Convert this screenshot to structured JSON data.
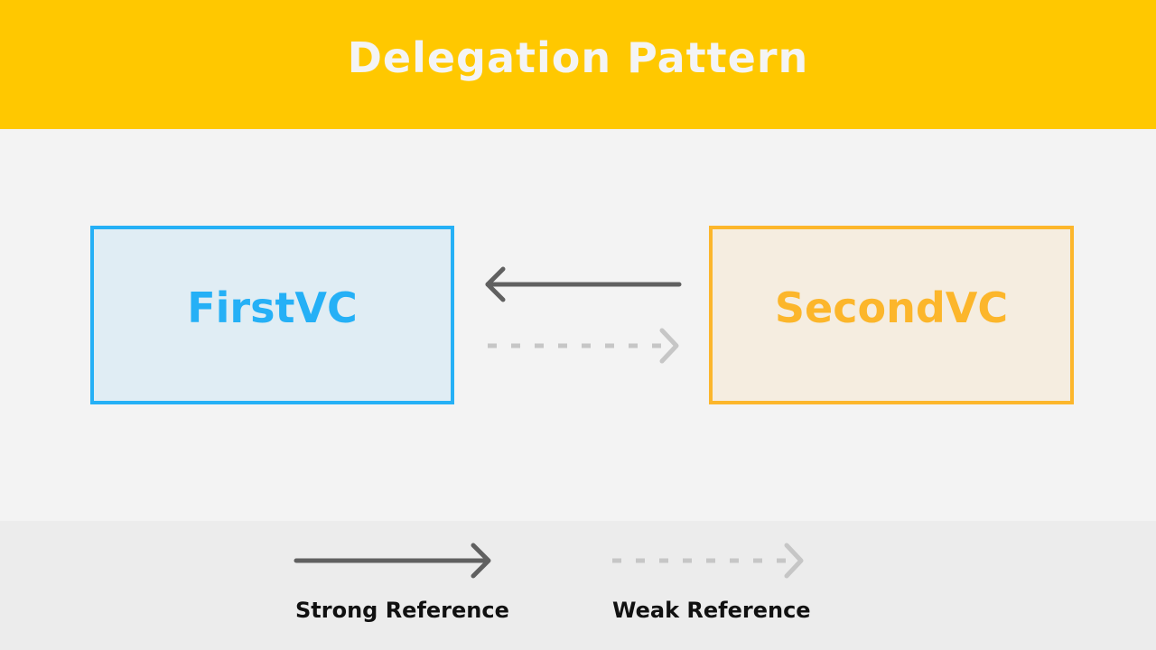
{
  "header": {
    "title": "Delegation Pattern",
    "background": "#ffc800"
  },
  "nodes": [
    {
      "id": "first",
      "label": "FirstVC",
      "border_color": "#25b0f6",
      "fill": "#e0edf4"
    },
    {
      "id": "second",
      "label": "SecondVC",
      "border_color": "#fcb62b",
      "fill": "#f5ede0"
    }
  ],
  "edges": [
    {
      "from": "SecondVC",
      "to": "FirstVC",
      "type": "strong",
      "style": "solid",
      "color": "#606060"
    },
    {
      "from": "FirstVC",
      "to": "SecondVC",
      "type": "weak",
      "style": "dashed",
      "color": "#c6c6c6"
    }
  ],
  "legend": {
    "items": [
      {
        "label": "Strong Reference",
        "style": "solid",
        "icon": "solid-arrow-icon"
      },
      {
        "label": "Weak Reference",
        "style": "dashed",
        "icon": "dashed-arrow-icon"
      }
    ]
  }
}
